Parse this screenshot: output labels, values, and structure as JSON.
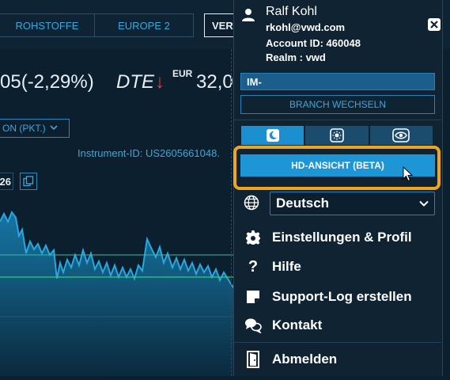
{
  "tabs": [
    {
      "label": "ROHSTOFFE"
    },
    {
      "label": "EUROPE 2"
    },
    {
      "label": "VER"
    }
  ],
  "quote": {
    "change": "05(-2,29%)",
    "symbol": "DTE",
    "currency": "EUR",
    "price": "32,0"
  },
  "unit_select": {
    "value": "ON (PKT.)"
  },
  "instrument_id": "Instrument-ID: US2605661048.",
  "small_label": "26",
  "user": {
    "name": "Ralf Kohl",
    "email": "rkohl@vwd.com",
    "account": "Account ID: 460048",
    "realm": "Realm : vwd"
  },
  "branch": {
    "current": "IM-",
    "switch_label": "BRANCH WECHSELN"
  },
  "hd_button": "HD-ANSICHT (BETA)",
  "language": {
    "selected": "Deutsch"
  },
  "menu": {
    "settings": "Einstellungen & Profil",
    "help": "Hilfe",
    "support_log": "Support-Log erstellen",
    "contact": "Kontakt",
    "logout": "Abmelden"
  },
  "colors": {
    "accent": "#1e95d5",
    "highlight": "#f0a51f",
    "negative": "#e0433a",
    "background": "#0b1f2e"
  }
}
